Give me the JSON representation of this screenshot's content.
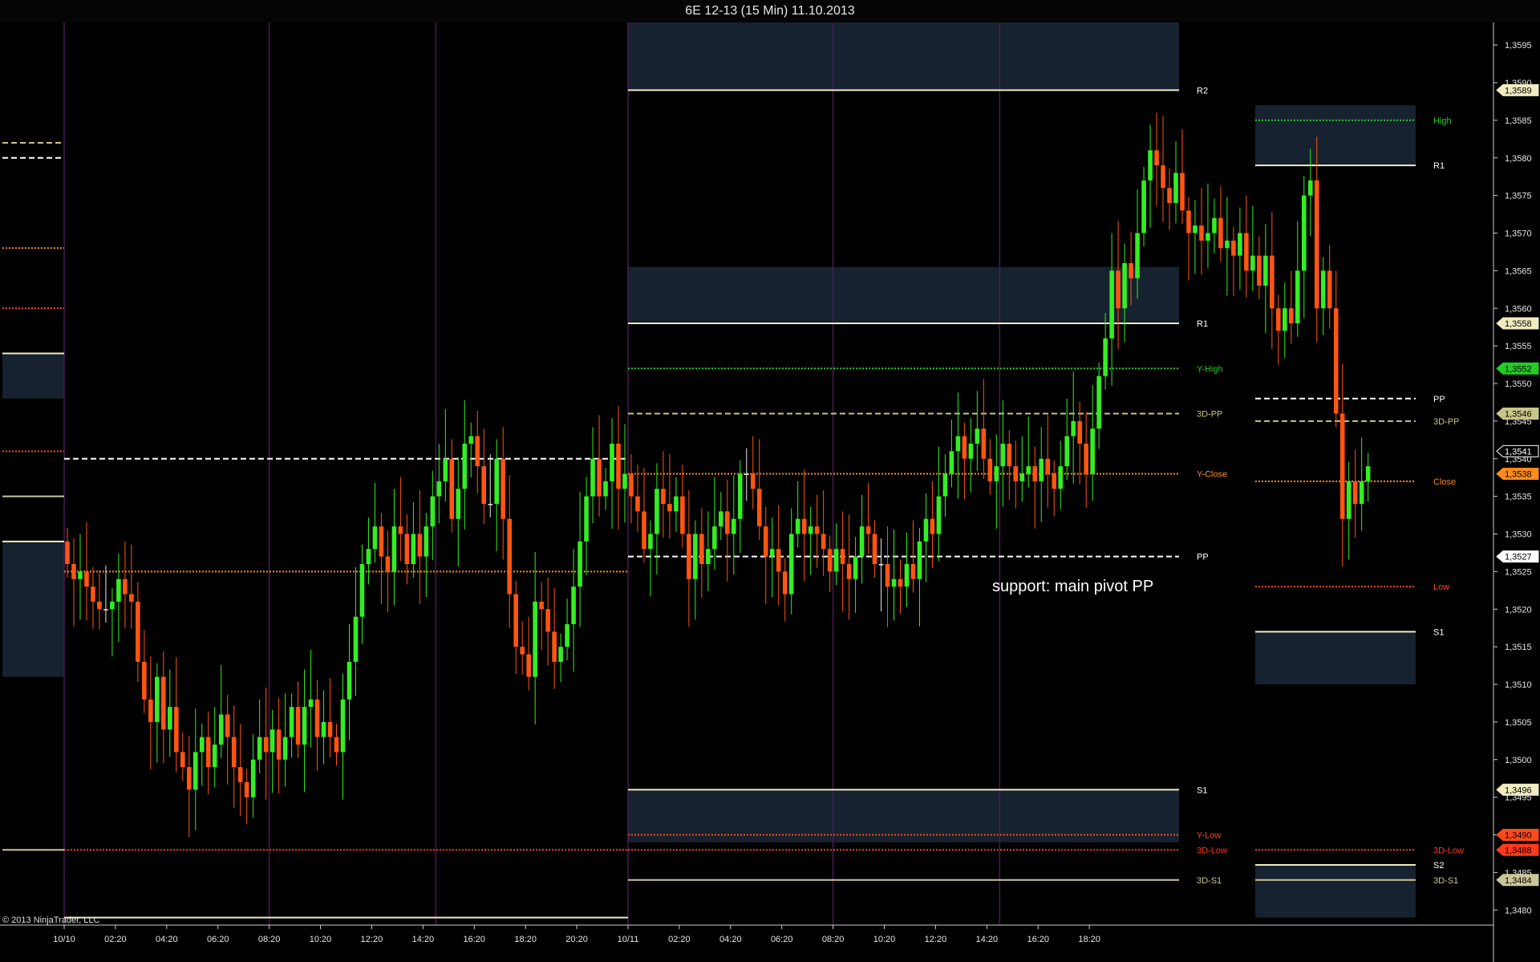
{
  "window": {
    "title": "6E 12-13 (15 Min)  11.10.2013",
    "copyright": "© 2013 NinjaTrader, LLC"
  },
  "annotation": "support: main pivot PP",
  "colors": {
    "background": "#000000",
    "up_candle": "#33ee22",
    "down_candle": "#ff5511",
    "doji_candle": "#e8e8e8",
    "session_line": "#4a1a55",
    "zone_fill": "#16222f",
    "pivot_solid": "#f0ecc0",
    "pp_dash": "#ffffff",
    "threed_pp": "#c9c58a",
    "y_high": "#22cc22",
    "y_close": "#ff8a1a",
    "y_low": "#ff4a1a",
    "threed_low": "#ff3a1a",
    "threed_s1": "#cbc69a"
  },
  "chart_data": {
    "type": "candlestick",
    "title": "6E 12-13 (15 Min)  11.10.2013",
    "ylim": [
      1.3478,
      1.3598
    ],
    "y_ticks": [
      "1,3480",
      "1,3485",
      "1,3490",
      "1,3495",
      "1,3500",
      "1,3505",
      "1,3510",
      "1,3515",
      "1,3520",
      "1,3525",
      "1,3530",
      "1,3535",
      "1,3540",
      "1,3545",
      "1,3550",
      "1,3555",
      "1,3560",
      "1,3565",
      "1,3570",
      "1,3575",
      "1,3580",
      "1,3585",
      "1,3590",
      "1,3595"
    ],
    "y_tick_values": [
      1.348,
      1.3485,
      1.349,
      1.3495,
      1.35,
      1.3505,
      1.351,
      1.3515,
      1.352,
      1.3525,
      1.353,
      1.3535,
      1.354,
      1.3545,
      1.355,
      1.3555,
      1.356,
      1.3565,
      1.357,
      1.3575,
      1.358,
      1.3585,
      1.359,
      1.3595
    ],
    "x_ticks": [
      "10/10",
      "02:20",
      "04:20",
      "06:20",
      "08:20",
      "10:20",
      "12:20",
      "14:20",
      "16:20",
      "18:20",
      "20:20",
      "10/11",
      "02:20",
      "04:20",
      "06:20",
      "08:20",
      "10:20",
      "12:20",
      "14:20",
      "16:20",
      "18:20"
    ],
    "x_tick_bars": [
      0,
      8,
      16,
      24,
      32,
      40,
      48,
      56,
      64,
      72,
      80,
      88,
      96,
      104,
      112,
      120,
      128,
      136,
      144,
      152,
      160
    ],
    "total_bars": 174,
    "session_starts": [
      0,
      32,
      58,
      88,
      120,
      146
    ],
    "price_flags": [
      {
        "label": "1,3589",
        "value": 1.3589,
        "color": "#f0ecc0"
      },
      {
        "label": "1,3558",
        "value": 1.3558,
        "color": "#f0ecc0"
      },
      {
        "label": "1,3552",
        "value": 1.3552,
        "color": "#22cc22"
      },
      {
        "label": "1,3546",
        "value": 1.3546,
        "color": "#c9c58a"
      },
      {
        "label": "1,3541",
        "value": 1.3541,
        "color": "#000000"
      },
      {
        "label": "1,3538",
        "value": 1.3538,
        "color": "#ff8a1a"
      },
      {
        "label": "1,3527",
        "value": 1.3527,
        "color": "#ffffff"
      },
      {
        "label": "1,3496",
        "value": 1.3496,
        "color": "#f0ecc0"
      },
      {
        "label": "1,3490",
        "value": 1.349,
        "color": "#ff4a1a"
      },
      {
        "label": "1,3488",
        "value": 1.3488,
        "color": "#ff3a1a"
      },
      {
        "label": "1,3484",
        "value": 1.3484,
        "color": "#cbc69a"
      }
    ],
    "candles_oc": [
      1.3529,
      1.3526,
      1.3526,
      1.3524,
      1.3524,
      1.3525,
      1.3525,
      1.3523,
      1.3523,
      1.3521,
      1.3521,
      1.352,
      1.352,
      1.352,
      1.352,
      1.3521,
      1.3521,
      1.3524,
      1.3524,
      1.3522,
      1.3522,
      1.3521,
      1.3521,
      1.3513,
      1.3513,
      1.3508,
      1.3508,
      1.3505,
      1.3505,
      1.3511,
      1.3511,
      1.3504,
      1.3504,
      1.3507,
      1.3507,
      1.3501,
      1.3501,
      1.3499,
      1.3499,
      1.3496,
      1.3496,
      1.3501,
      1.3501,
      1.3503,
      1.3503,
      1.3499,
      1.3499,
      1.3502,
      1.3502,
      1.3506,
      1.3506,
      1.3503,
      1.3503,
      1.3499,
      1.3499,
      1.3497,
      1.3497,
      1.3495,
      1.3495,
      1.35,
      1.35,
      1.3503,
      1.3503,
      1.3501,
      1.3501,
      1.3504,
      1.3504,
      1.35,
      1.35,
      1.3503,
      1.3503,
      1.3507,
      1.3507,
      1.3502,
      1.3502,
      1.3507,
      1.3507,
      1.3508,
      1.3508,
      1.3503,
      1.3503,
      1.3505,
      1.3505,
      1.3503,
      1.3503,
      1.3501,
      1.3501,
      1.3508,
      1.3508,
      1.3513,
      1.3513,
      1.3519,
      1.3519,
      1.3526,
      1.3526,
      1.3528,
      1.3528,
      1.3531,
      1.3531,
      1.3527,
      1.3527,
      1.3525,
      1.3525,
      1.3531,
      1.3531,
      1.353,
      1.353,
      1.3526,
      1.3526,
      1.353,
      1.353,
      1.3527,
      1.3527,
      1.3531,
      1.3531,
      1.3535,
      1.3535,
      1.3537,
      1.3537,
      1.354,
      1.354,
      1.3532,
      1.3532,
      1.3536,
      1.3536,
      1.3542,
      1.3542,
      1.3543,
      1.3543,
      1.3539,
      1.3539,
      1.3534,
      1.3534,
      1.3534,
      1.3534,
      1.354,
      1.354,
      1.3532,
      1.3532,
      1.3522,
      1.3522,
      1.3515,
      1.3515,
      1.3514,
      1.3514,
      1.3511,
      1.3511,
      1.3521,
      1.3521,
      1.352,
      1.352,
      1.3517,
      1.3517,
      1.3513,
      1.3513,
      1.3515,
      1.3515,
      1.3518,
      1.3518,
      1.3523,
      1.3523,
      1.3529,
      1.3529,
      1.3535,
      1.3535,
      1.354,
      1.354,
      1.3535,
      1.3535,
      1.3537,
      1.3537,
      1.3542,
      1.3542,
      1.3536,
      1.3536,
      1.3538,
      1.3538,
      1.3535,
      1.3535,
      1.3533,
      1.3533,
      1.3528,
      1.3528,
      1.353,
      1.353,
      1.3536,
      1.3536,
      1.3534,
      1.3534,
      1.3533,
      1.3533,
      1.3535,
      1.3535,
      1.353,
      1.353,
      1.3524,
      1.3524,
      1.353,
      1.353,
      1.3526,
      1.3526,
      1.3528,
      1.3528,
      1.3531,
      1.3531,
      1.3533,
      1.3533,
      1.353,
      1.353,
      1.3532,
      1.3532,
      1.3538,
      1.3538,
      1.3538,
      1.3538,
      1.3536,
      1.3536,
      1.3531,
      1.3531,
      1.3527,
      1.3527,
      1.3528,
      1.3528,
      1.3525,
      1.3525,
      1.3522,
      1.3522,
      1.353,
      1.353,
      1.3532,
      1.3532,
      1.353,
      1.353,
      1.3531,
      1.3531,
      1.353,
      1.353,
      1.3528,
      1.3528,
      1.3525,
      1.3525,
      1.3528,
      1.3528,
      1.3526,
      1.3526,
      1.3524,
      1.3524,
      1.3527,
      1.3527,
      1.3531,
      1.3531,
      1.353,
      1.353,
      1.3526,
      1.3526,
      1.3526,
      1.3526,
      1.3523,
      1.3523,
      1.3524,
      1.3524,
      1.3523,
      1.3523,
      1.3526,
      1.3526,
      1.3524,
      1.3524,
      1.3529,
      1.3529,
      1.3532,
      1.3532,
      1.353,
      1.353,
      1.3535,
      1.3535,
      1.3538,
      1.3538,
      1.3541,
      1.3541,
      1.3543,
      1.3543,
      1.354,
      1.354,
      1.3542,
      1.3542,
      1.3544,
      1.3544,
      1.354,
      1.354,
      1.3537,
      1.3537,
      1.3539,
      1.3539,
      1.3542,
      1.3542,
      1.3539,
      1.3539,
      1.3537,
      1.3537,
      1.3538,
      1.3538,
      1.3539,
      1.3539,
      1.3537,
      1.3537,
      1.354,
      1.354,
      1.3538,
      1.3538,
      1.3536,
      1.3536,
      1.3539,
      1.3539,
      1.3543,
      1.3543,
      1.3545,
      1.3545,
      1.3542,
      1.3542,
      1.3538,
      1.3538,
      1.3544,
      1.3544,
      1.3551,
      1.3551,
      1.3556,
      1.3556,
      1.3565,
      1.3565,
      1.356,
      1.356,
      1.3566,
      1.3566,
      1.3564,
      1.3564,
      1.357,
      1.357,
      1.3577,
      1.3577,
      1.3581,
      1.3581,
      1.3579,
      1.3579,
      1.3576,
      1.3576,
      1.3574,
      1.3574,
      1.3578,
      1.3578,
      1.3573,
      1.3573,
      1.357,
      1.357,
      1.3571,
      1.3571,
      1.3569,
      1.3569,
      1.357,
      1.357,
      1.3572,
      1.3572,
      1.3568,
      1.3568,
      1.3569,
      1.3569,
      1.3567,
      1.3567,
      1.357,
      1.357,
      1.3565,
      1.3565,
      1.3567,
      1.3567,
      1.3563,
      1.3563,
      1.3567,
      1.3567,
      1.356,
      1.356,
      1.3557,
      1.3557,
      1.356,
      1.356,
      1.3558,
      1.3558,
      1.3565,
      1.3565,
      1.3575,
      1.3575,
      1.3577,
      1.3577,
      1.356,
      1.356,
      1.3565,
      1.3565,
      1.356,
      1.356,
      1.3546,
      1.3546,
      1.3532,
      1.3532,
      1.3537,
      1.3537,
      1.3534,
      1.3534,
      1.3537,
      1.3537,
      1.3539
    ]
  },
  "levels": [
    {
      "name": "R2",
      "value": 1.3589,
      "start": 88,
      "end": 174,
      "style": "solid",
      "color": "#f0ecc0",
      "label_color": "#ffffff",
      "zone_top": 1.3598
    },
    {
      "name": "R1",
      "value": 1.3558,
      "start": 88,
      "end": 174,
      "style": "solid",
      "color": "#f0ecc0",
      "label_color": "#ffffff",
      "zone_top": 1.35655
    },
    {
      "name": "Y-High",
      "value": 1.3552,
      "start": 88,
      "end": 174,
      "style": "dotted",
      "color": "#22cc22",
      "label_color": "#22cc22"
    },
    {
      "name": "3D-PP",
      "value": 1.3546,
      "start": 88,
      "end": 174,
      "style": "dashed",
      "color": "#c9c58a",
      "label_color": "#c9c58a"
    },
    {
      "name": "Y-Close",
      "value": 1.3538,
      "start": 88,
      "end": 174,
      "style": "dotted",
      "color": "#ff8a1a",
      "label_color": "#ff8a1a"
    },
    {
      "name": "PP",
      "value": 1.3527,
      "start": 88,
      "end": 174,
      "style": "dashed",
      "color": "#ffffff",
      "label_color": "#ffffff"
    },
    {
      "name": "S1",
      "value": 1.3496,
      "start": 88,
      "end": 174,
      "style": "solid",
      "color": "#f0ecc0",
      "label_color": "#ffffff",
      "zone_bottom": 1.3489
    },
    {
      "name": "Y-Low",
      "value": 1.349,
      "start": 88,
      "end": 174,
      "style": "dotted",
      "color": "#ff4a1a",
      "label_color": "#ff4a1a"
    },
    {
      "name": "3D-Low",
      "value": 1.3488,
      "start": 88,
      "end": 174,
      "style": "dotted",
      "color": "#ff3a1a",
      "label_color": "#ff3a1a"
    },
    {
      "name": "3D-S1",
      "value": 1.3484,
      "start": 88,
      "end": 174,
      "style": "solid",
      "color": "#cbc69a",
      "label_color": "#cbc69a"
    }
  ],
  "prior_levels": [
    {
      "value": 1.354,
      "start": 0,
      "end": 88,
      "style": "dashed",
      "color": "#ffffff"
    },
    {
      "value": 1.3525,
      "start": 0,
      "end": 88,
      "style": "dotted",
      "color": "#ff8a1a"
    },
    {
      "value": 1.3488,
      "start": 0,
      "end": 88,
      "style": "dotted",
      "color": "#ff3a1a"
    },
    {
      "value": 1.3479,
      "start": 0,
      "end": 88,
      "style": "solid",
      "color": "#f0ecc0"
    }
  ],
  "left_levels": [
    {
      "value": 1.3582,
      "style": "dashed",
      "color": "#c9c58a"
    },
    {
      "value": 1.358,
      "style": "dashed",
      "color": "#ffffff"
    },
    {
      "value": 1.3568,
      "style": "dotted",
      "color": "#ff8a1a"
    },
    {
      "value": 1.356,
      "style": "dotted",
      "color": "#ff4a1a"
    },
    {
      "value": 1.3554,
      "style": "solid",
      "color": "#f0ecc0",
      "zone_bottom": 1.3548
    },
    {
      "value": 1.3541,
      "style": "dotted",
      "color": "#ff4a1a"
    },
    {
      "value": 1.3535,
      "style": "solid",
      "color": "#cbc69a"
    },
    {
      "value": 1.3529,
      "style": "solid",
      "color": "#f0ecc0",
      "zone_bottom": 1.3511
    },
    {
      "value": 1.3488,
      "style": "solid",
      "color": "#cbc69a"
    }
  ],
  "right_levels": [
    {
      "name": "High",
      "value": 1.3585,
      "style": "dotted",
      "color": "#22cc22",
      "label_color": "#22cc22",
      "zone_top": 1.3587
    },
    {
      "name": "R1",
      "value": 1.3579,
      "style": "solid",
      "color": "#f0ecc0",
      "label_color": "#ffffff"
    },
    {
      "name": "PP",
      "value": 1.3548,
      "style": "dashed",
      "color": "#ffffff",
      "label_color": "#ffffff"
    },
    {
      "name": "3D-PP",
      "value": 1.3545,
      "style": "dashed",
      "color": "#c9c58a",
      "label_color": "#c9c58a"
    },
    {
      "name": "Close",
      "value": 1.3537,
      "style": "dotted",
      "color": "#ff8a1a",
      "label_color": "#ff8a1a"
    },
    {
      "name": "Low",
      "value": 1.3523,
      "style": "dotted",
      "color": "#ff4a1a",
      "label_color": "#ff4a1a"
    },
    {
      "name": "S1",
      "value": 1.3517,
      "style": "solid",
      "color": "#f0ecc0",
      "label_color": "#ffffff",
      "zone_bottom": 1.351
    },
    {
      "name": "3D-Low",
      "value": 1.3488,
      "style": "dotted",
      "color": "#ff3a1a",
      "label_color": "#ff3a1a"
    },
    {
      "name": "S2",
      "value": 1.3486,
      "style": "solid",
      "color": "#f0ecc0",
      "label_color": "#ffffff",
      "zone_bottom": 1.3479
    },
    {
      "name": "3D-S1",
      "value": 1.3484,
      "style": "solid",
      "color": "#cbc69a",
      "label_color": "#cbc69a"
    }
  ]
}
